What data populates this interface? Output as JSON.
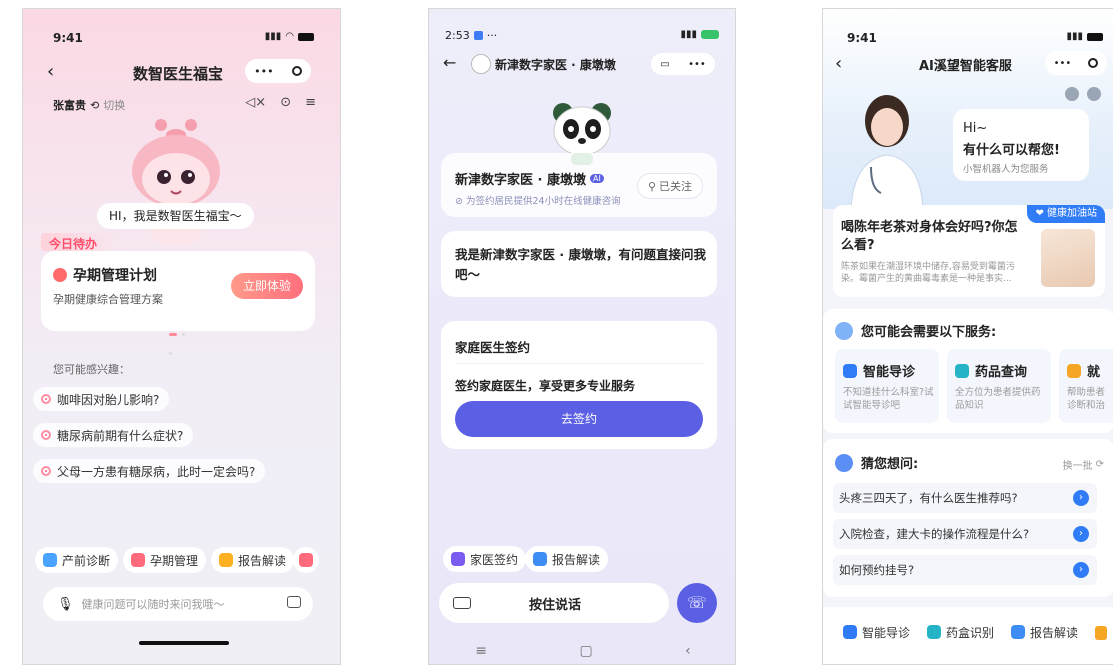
{
  "phone1": {
    "status_time": "9:41",
    "title": "数智医生福宝",
    "user_name": "张富贵",
    "switch_label": "切换",
    "greeting": "HI，我是数智医生福宝～",
    "todo_label": "今日待办",
    "plan_title": "孕期管理计划",
    "plan_subtitle": "孕期健康综合管理方案",
    "plan_button": "立即体验",
    "interest_label": "您可能感兴趣：",
    "questions": [
      "咖啡因对胎儿影响?",
      "糖尿病前期有什么症状?",
      "父母一方患有糖尿病，此时一定会吗?"
    ],
    "shortcuts": [
      "产前诊断",
      "孕期管理",
      "报告解读"
    ],
    "input_placeholder": "健康问题可以随时来问我哦～",
    "colors": {
      "accent": "#ff6f6f",
      "todo": "#ff5a6b"
    }
  },
  "phone2": {
    "status_time": "2:53",
    "title": "新津数字家医 · 康墩墩",
    "profile_name": "新津数字家医 · 康墩墩",
    "profile_badge": "AI",
    "follow_label": "已关注",
    "profile_desc": "为签约居民提供24小时在线健康咨询",
    "intro_message": "我是新津数字家医 · 康墩墩，有问题直接问我吧～",
    "sign_title": "家庭医生签约",
    "sign_desc": "签约家庭医生，享受更多专业服务",
    "sign_button": "去签约",
    "shortcuts": [
      "家医签约",
      "报告解读"
    ],
    "hold_to_talk": "按住说话",
    "colors": {
      "accent": "#5b5fe3"
    }
  },
  "phone3": {
    "status_time": "9:41",
    "title": "AI溪望智能客服",
    "hi_text": "Hi~",
    "help_text": "有什么可以帮您!",
    "bot_text": "小智机器人为您服务",
    "article_tag": "健康加油站",
    "article_title": "喝陈年老茶对身体会好吗?你怎么看?",
    "article_desc": "陈茶如果在潮湿环境中储存,容易受到霉菌污染。霉菌产生的黄曲霉毒素是一种是事实...",
    "services_heading": "您可能会需要以下服务:",
    "services": [
      {
        "title": "智能导诊",
        "desc": "不知道挂什么科室?试试智能导诊吧"
      },
      {
        "title": "药品查询",
        "desc": "全方位为患者提供药品知识"
      },
      {
        "title": "就",
        "desc": "帮助患者诊断和治"
      }
    ],
    "guess_heading": "猜您想问:",
    "refresh_label": "换一批",
    "guess_questions": [
      "头疼三四天了，有什么医生推荐吗?",
      "入院检查，建大卡的操作流程是什么?",
      "如何预约挂号?"
    ],
    "bottom_shortcuts": [
      "智能导诊",
      "药盒识别",
      "报告解读"
    ],
    "colors": {
      "accent": "#2f7cf6"
    }
  }
}
